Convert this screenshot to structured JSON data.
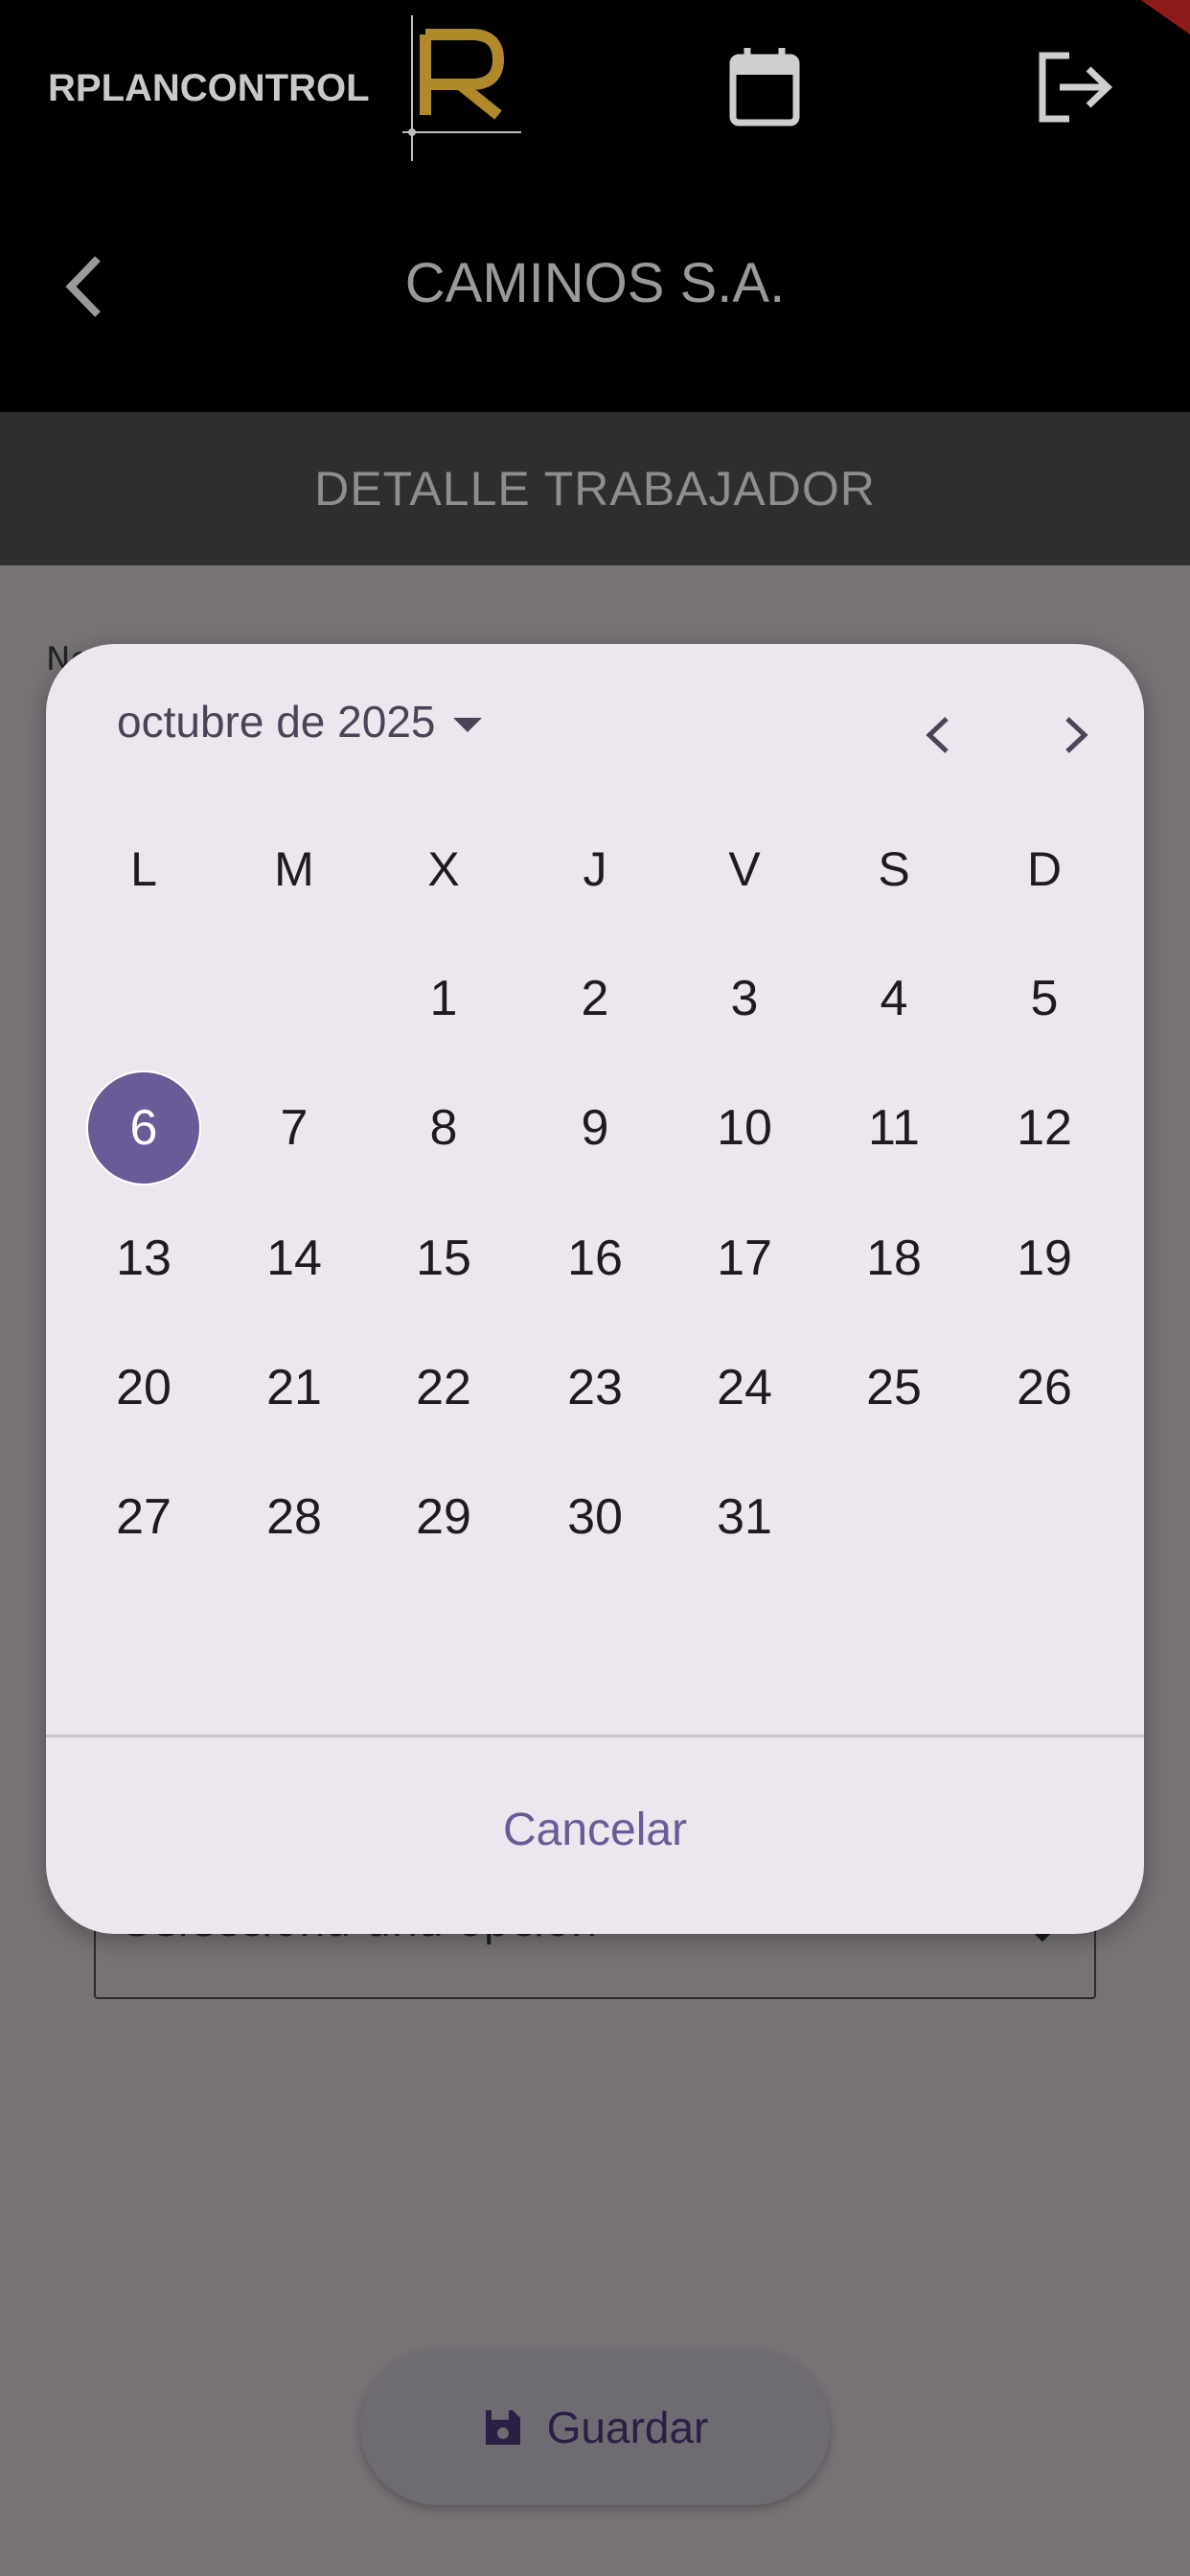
{
  "app": {
    "logo_text": "RPLANCONTROL",
    "logo_letter": "R",
    "brand_color": "#b08a2a",
    "company": "CAMINOS S.A.",
    "section_title": "DETALLE TRABAJADOR"
  },
  "icons": {
    "calendar": "calendar-icon",
    "logout": "logout-icon",
    "back": "chevron-left-icon",
    "save": "floppy-disk-icon"
  },
  "form": {
    "field_label": "No",
    "select_placeholder": "Selecciona una opción",
    "save_label": "Guardar"
  },
  "date_picker": {
    "month_label": "octubre de 2025",
    "weekdays": [
      "L",
      "M",
      "X",
      "J",
      "V",
      "S",
      "D"
    ],
    "selected_day": "6",
    "weeks": [
      [
        "",
        "",
        "1",
        "2",
        "3",
        "4",
        "5"
      ],
      [
        "6",
        "7",
        "8",
        "9",
        "10",
        "11",
        "12"
      ],
      [
        "13",
        "14",
        "15",
        "16",
        "17",
        "18",
        "19"
      ],
      [
        "20",
        "21",
        "22",
        "23",
        "24",
        "25",
        "26"
      ],
      [
        "27",
        "28",
        "29",
        "30",
        "31",
        "",
        ""
      ]
    ],
    "cancel_label": "Cancelar",
    "accent_color": "#6b5a98"
  }
}
